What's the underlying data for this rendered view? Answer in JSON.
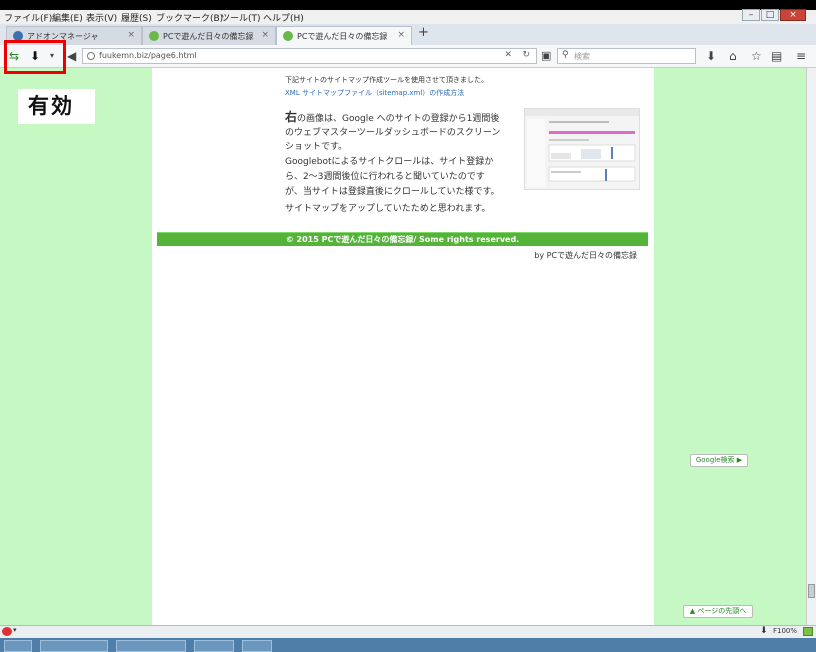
{
  "menu": [
    "ファイル(F)",
    "編集(E)",
    "表示(V)",
    "履歴(S)",
    "ブックマーク(B)",
    "ツール(T)",
    "ヘルプ(H)"
  ],
  "window_buttons": {
    "minimize": "–",
    "maximize": "□",
    "close": "×"
  },
  "tabs": [
    {
      "label": "アドオンマネージャ",
      "close": "×",
      "color": "#3a6fb0"
    },
    {
      "label": "PCで遊んだ日々の備忘録",
      "close": "×",
      "color": "#6ab84a"
    },
    {
      "label": "PCで遊んだ日々の備忘録",
      "close": "×",
      "color": "#6ab84a"
    }
  ],
  "new_tab": "+",
  "url": "fuukemn.biz/page6.html",
  "search_placeholder": "検索",
  "overlay_label": "有効",
  "article": {
    "line1": "下記サイトのサイトマップ作成ツールを使用させて頂きました。",
    "line2": "XML サイトマップファイル（sitemap.xml）の作成方法",
    "p_big": "右",
    "p1": "の画像は、Google へのサイトの登録から1週間後",
    "p2": "のウェブマスターツールダッシュボードのスクリーン",
    "p3": "ショットです。",
    "p4": "Googlebotによるサイトクロールは、サイト登録か",
    "p5": "ら、2～3週間後位に行われると聞いていたのです",
    "p6": "が、当サイトは登録直後にクロールしていた様です。",
    "p7": "サイトマップをアップしていたためと思われます。"
  },
  "footer": "© 2015 PCで遊んだ日々の備忘録/ Some rights reserved.",
  "byline": "by PCで遊んだ日々の備忘録",
  "google_search_button": "Google検索 ▶",
  "page_top_button": "▲ ページの先頭へ",
  "zoom": "F100%"
}
